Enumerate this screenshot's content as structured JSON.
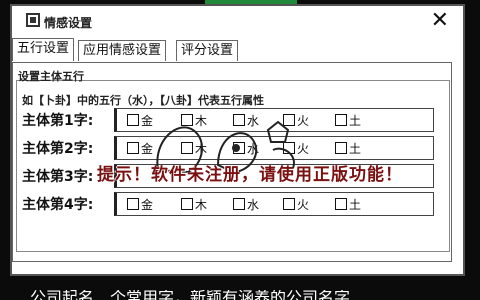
{
  "window": {
    "title": "情感设置",
    "close_label": "✕"
  },
  "tabs": [
    {
      "label": "五行设置"
    },
    {
      "label": "应用情感设置"
    },
    {
      "label": "评分设置"
    }
  ],
  "group": {
    "label": "设置主体五行",
    "description": "如【卜卦】中的五行（水），【八卦】代表五行属性"
  },
  "elements": [
    "金",
    "木",
    "水",
    "火",
    "土"
  ],
  "rows": [
    {
      "label": "主体第1字:"
    },
    {
      "label": "主体第2字:"
    },
    {
      "label": "主体第3字:"
    },
    {
      "label": "主体第4字:"
    }
  ],
  "warning": "提示！软件未注册，请使用正版功能！",
  "bottom_banner": "公司起名＿个常用字，新颖有涵养的公司名字"
}
